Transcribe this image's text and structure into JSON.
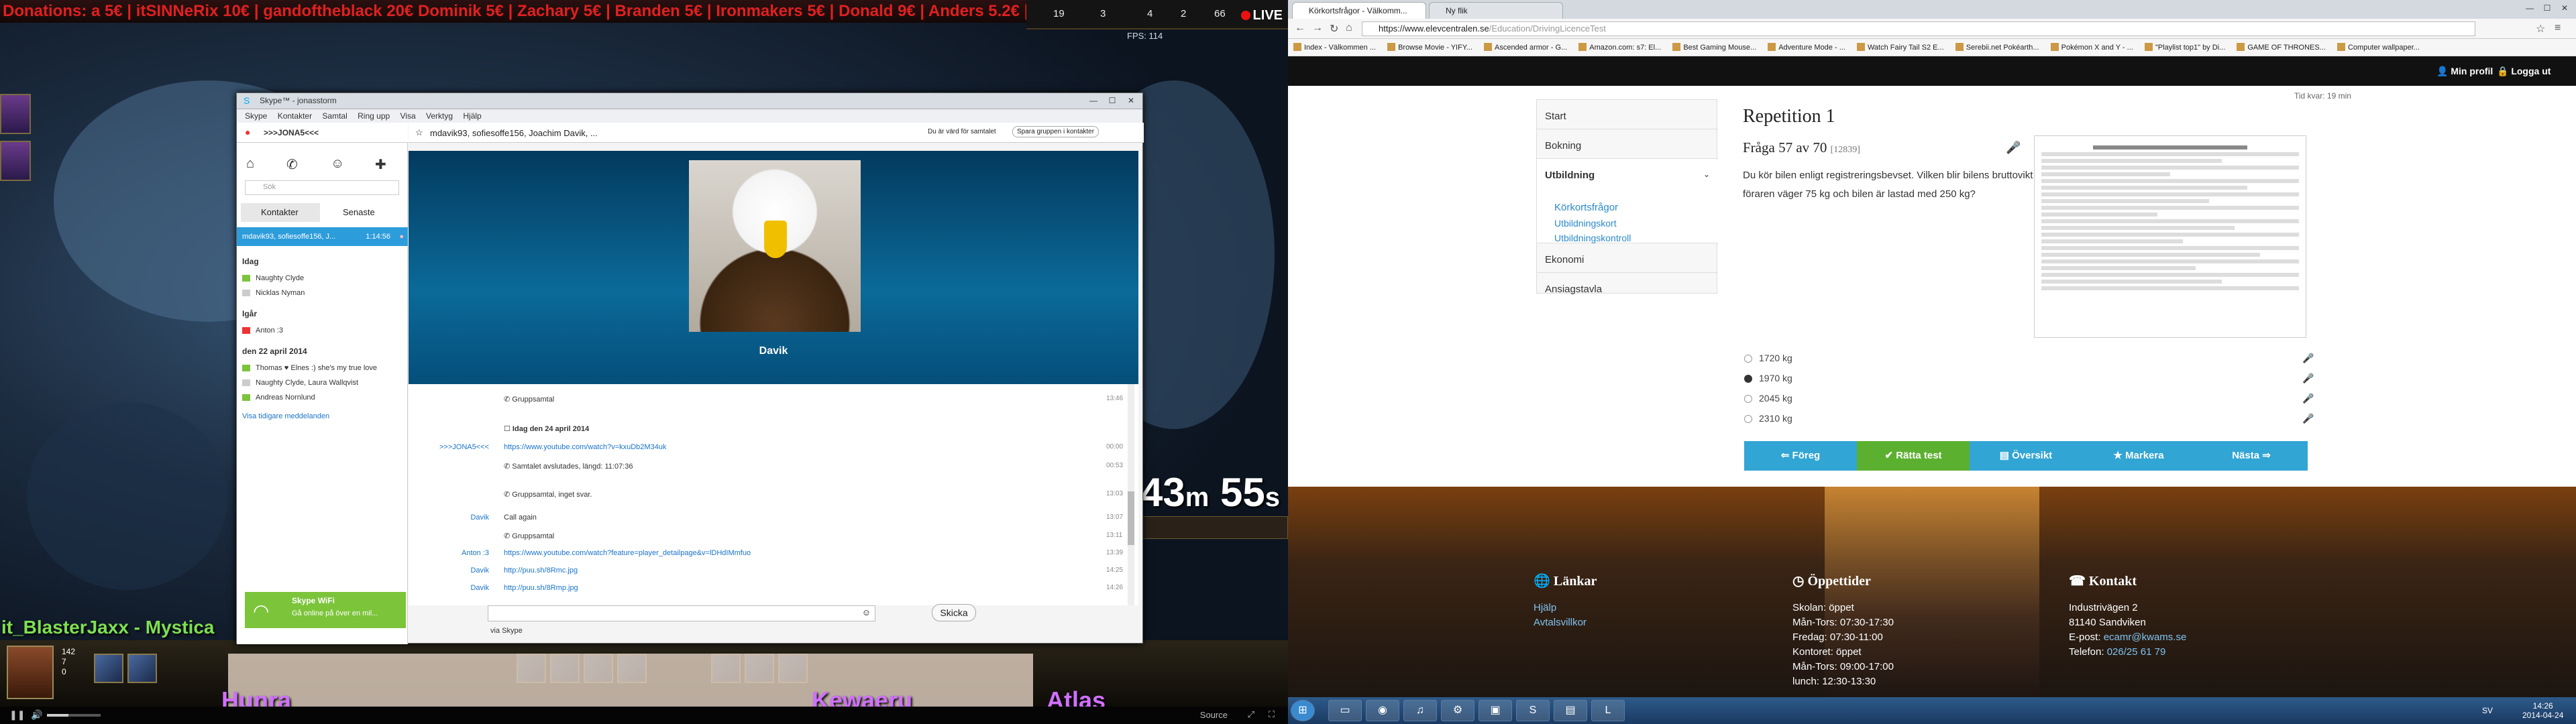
{
  "stream": {
    "donation_bar": "Donations: a 5€ | itSINNeRix 10€ | gandoftheblack 20€ Dominik 5€ | Zachary 5€ | Branden 5€ | Ironmakers 5€ | Donald 9€ | Anders 5.2€ | Alex 5€",
    "hud_stats": [
      "19",
      "3",
      "4",
      "2",
      "66"
    ],
    "hud_sub": "FPS: 114",
    "live_label": "LIVE",
    "timer_min": "43",
    "timer_min_unit": "m",
    "timer_sec": "55",
    "timer_sec_unit": "s",
    "player_names": "it_BlasterJaxx - Mystica",
    "cam_names": [
      "Hunra",
      "Kewaeru",
      "Atlas"
    ],
    "player_stats": [
      "142",
      "7",
      "0"
    ],
    "source_label": "Source"
  },
  "skype": {
    "window_title": "Skype™ - jonasstorm",
    "menu": [
      "Skype",
      "Kontakter",
      "Samtal",
      "Ring upp",
      "Visa",
      "Verktyg",
      "Hjälp"
    ],
    "user_name": ">>>JONA5<<<",
    "search_placeholder": "Sök",
    "tabs": [
      "Kontakter",
      "Senaste"
    ],
    "active_call": "mdavik93, sofiesoffe156, J...",
    "active_call_time": "1:14:56",
    "groups": [
      {
        "label": "Idag",
        "items": [
          "Naughty Clyde",
          "Nicklas Nyman"
        ]
      },
      {
        "label": "Igår",
        "items": [
          "Anton :3"
        ]
      },
      {
        "label": "den 22 april 2014",
        "items": [
          "Thomas ♥ Elnes :) she's my true love",
          "Naughty Clyde, Laura Wallqvist",
          "Andreas Nornlund"
        ]
      }
    ],
    "more_messages": "Visa tidigare meddelanden",
    "wifi_title": "Skype WiFi",
    "wifi_text": "Gå online på över en mil...",
    "chat_title": "mdavik93, sofiesoffe156, Joachim Davik, ...",
    "host_text": "Du är värd för samtalet",
    "save_group": "Spara gruppen i kontakter",
    "caller": "Davik",
    "messages": [
      {
        "sender": "",
        "text": "Gruppsamtal",
        "time": "13:46",
        "link": false
      },
      {
        "sender": "",
        "text": "Idag den 24 april 2014",
        "time": "",
        "link": false
      },
      {
        "sender": ">>>JONA5<<<",
        "text": "https://www.youtube.com/watch?v=kxuDb2M34uk",
        "time": "00:00",
        "link": true
      },
      {
        "sender": "",
        "text": "Samtalet avslutades, längd: 11:07:36",
        "time": "00:53",
        "link": false
      },
      {
        "sender": "",
        "text": "Gruppsamtal, inget svar.",
        "time": "13:03",
        "link": false
      },
      {
        "sender": "Davik",
        "text": "Call again",
        "time": "13:07",
        "link": false
      },
      {
        "sender": "",
        "text": "Gruppsamtal",
        "time": "13:11",
        "link": false
      },
      {
        "sender": "Anton :3",
        "text": "https://www.youtube.com/watch?feature=player_detailpage&v=lDHdIMmfuo",
        "time": "13:39",
        "link": true
      },
      {
        "sender": "Davik",
        "text": "http://puu.sh/8Rmc.jpg",
        "time": "14:25",
        "link": true
      },
      {
        "sender": "Davik",
        "text": "http://puu.sh/8Rmp.jpg",
        "time": "14:26",
        "link": true
      }
    ],
    "send_label": "Skicka",
    "via_label": "via Skype"
  },
  "browser": {
    "tabs": [
      "Körkortsfrågor - Välkomm...",
      "Ny flik"
    ],
    "url_host": "https://www.elevcentralen.se",
    "url_path": "/Education/DrivingLicenceTest",
    "bookmarks": [
      "Index - Välkommen ...",
      "Browse Movie - YIFY...",
      "Ascended armor - G...",
      "Amazon.com: s7: El...",
      "Best Gaming Mouse...",
      "Adventure Mode - ...",
      "Watch Fairy Tail S2 E...",
      "Serebii.net Pokéarth...",
      "Pokémon X and Y - ...",
      "\"Playlist top1\" by Di...",
      "GAME OF THRONES...",
      "Computer wallpaper..."
    ],
    "header": {
      "profile": "Min profil",
      "logout": "Logga ut"
    },
    "nav": [
      "Start",
      "Bokning",
      "Utbildning",
      "Ekonomi",
      "Ansiagstavla"
    ],
    "subnav": [
      "Körkortsfrågor",
      "Utbildningskort",
      "Utbildningskontroll"
    ],
    "time_left": "Tid kvar: 19 min",
    "question_title": "Repetition 1",
    "question_no": "Fråga 57 av 70",
    "question_id": "[12839]",
    "question_text": "Du kör bilen enligt registreringsbevset. Vilken blir bilens bruttovikt om föraren väger 75 kg och bilen är lastad med 250 kg?",
    "options": [
      {
        "label": "1720 kg",
        "selected": false
      },
      {
        "label": "1970 kg",
        "selected": true
      },
      {
        "label": "2045 kg",
        "selected": false
      },
      {
        "label": "2310 kg",
        "selected": false
      }
    ],
    "buttons": [
      {
        "label": "⇐ Föreg",
        "color": "#31a5d4"
      },
      {
        "label": "✔ Rätta test",
        "color": "#5cb030"
      },
      {
        "label": "▤ Översikt",
        "color": "#31a5d4"
      },
      {
        "label": "★ Markera",
        "color": "#31a5d4"
      },
      {
        "label": "Nästa ⇒",
        "color": "#31a5d4"
      }
    ],
    "footer": {
      "links_title": "Länkar",
      "links": [
        "Hjälp",
        "Avtalsvillkor"
      ],
      "hours_title": "Öppettider",
      "hours": [
        "Skolan: öppet",
        "Mån-Tors: 07:30-17:30",
        "Fredag: 07:30-11:00",
        "Kontoret: öppet",
        "Mån-Tors: 09:00-17:00",
        "lunch: 12:30-13:30"
      ],
      "contact_title": "Kontakt",
      "contact": [
        "Industrivägen 2",
        "81140 Sandviken"
      ],
      "email_label": "E-post:",
      "email": "ecamr@kwams.se",
      "phone_label": "Telefon:",
      "phone": "026/25 61 79"
    },
    "taskbar": {
      "lang": "SV",
      "time": "14:26",
      "date": "2014-04-24"
    }
  }
}
